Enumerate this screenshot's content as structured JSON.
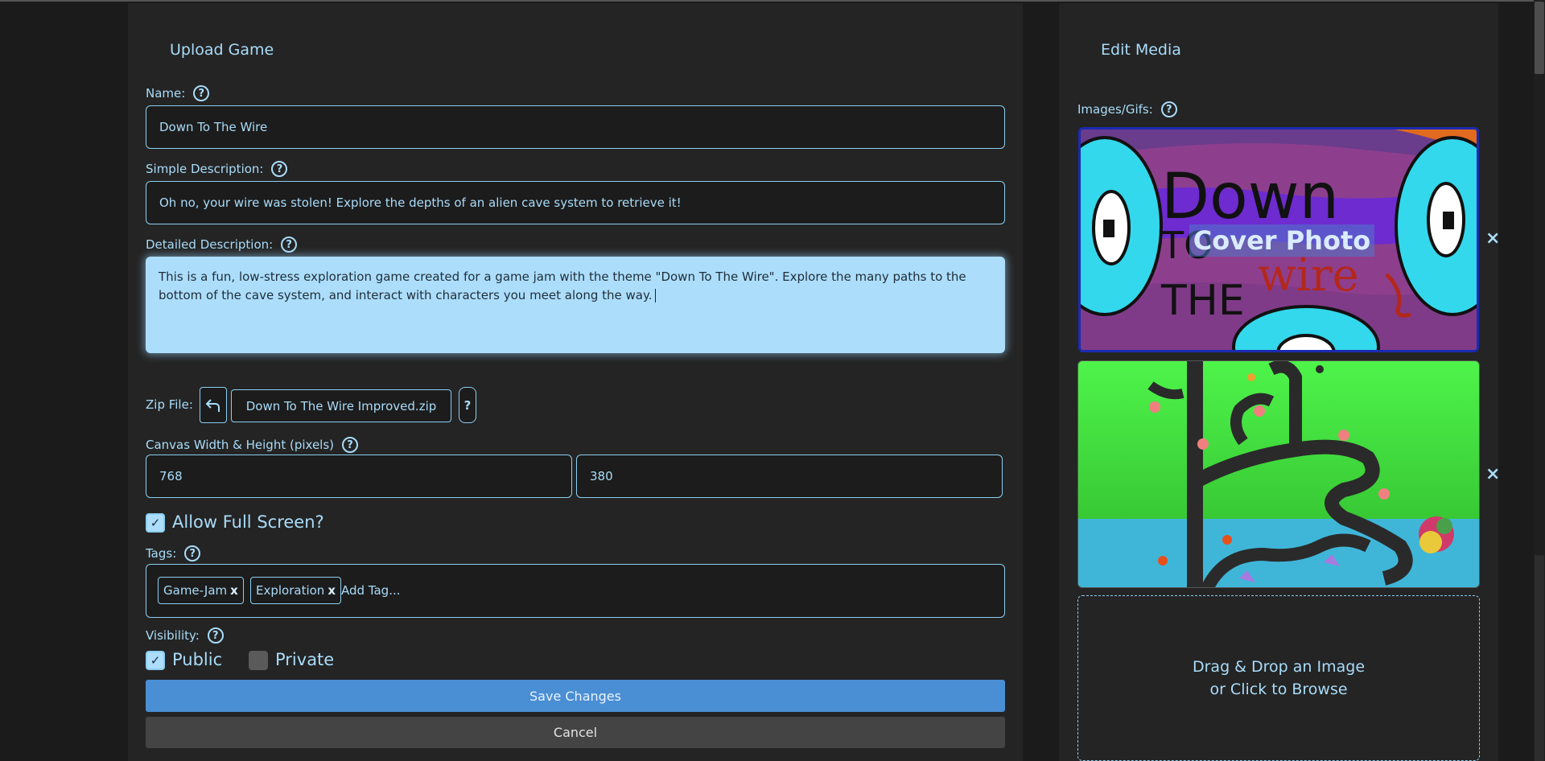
{
  "upload": {
    "title": "Upload Game",
    "name_label": "Name:",
    "name_value": "Down To The Wire",
    "simple_label": "Simple Description:",
    "simple_value": "Oh no, your wire was stolen! Explore the depths of an alien cave system to retrieve it!",
    "detailed_label": "Detailed Description:",
    "detailed_value": "This is a fun, low-stress exploration game created for a game jam with the theme \"Down To The Wire\". Explore the many paths to the bottom of the cave system, and interact with characters you meet along the way.",
    "zip_label": "Zip File:",
    "zip_filename": "Down To The Wire Improved.zip",
    "zip_help": "?",
    "canvas_label": "Canvas Width & Height (pixels)",
    "canvas_width": "768",
    "canvas_height": "380",
    "fullscreen_label": "Allow Full Screen?",
    "fullscreen_checked": true,
    "tags_label": "Tags:",
    "tags": [
      {
        "label": "Game-Jam"
      },
      {
        "label": "Exploration"
      }
    ],
    "tag_remove_glyph": "x",
    "add_tag_placeholder": "Add Tag...",
    "visibility_label": "Visibility:",
    "public_label": "Public",
    "private_label": "Private",
    "public_checked": true,
    "private_checked": false,
    "save_label": "Save Changes",
    "cancel_label": "Cancel",
    "help_glyph": "?"
  },
  "media": {
    "title": "Edit Media",
    "images_label": "Images/Gifs:",
    "cover_overlay": "Cover Photo",
    "cover_art_text": {
      "down": "Down",
      "to": "TO",
      "the": "THE",
      "wire": "wire"
    },
    "remove_glyph": "×",
    "dropzone_line1": "Drag & Drop an Image",
    "dropzone_line2": "or Click to Browse"
  },
  "colors": {
    "accent": "#a9dcf9",
    "panel": "#242424",
    "primary_button": "#4a8ed4",
    "secondary_button": "#444444"
  }
}
